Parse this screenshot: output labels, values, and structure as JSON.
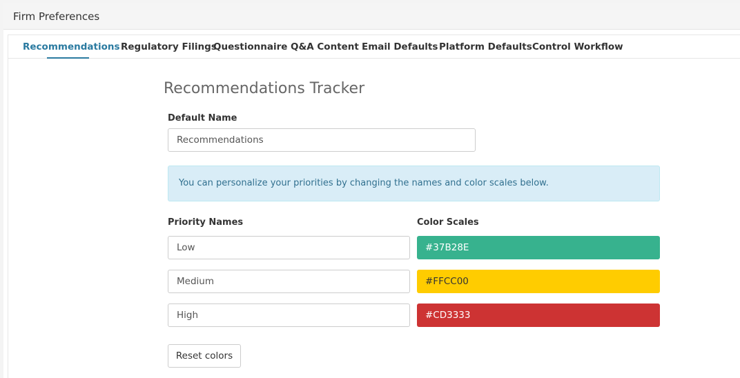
{
  "header": {
    "title": "Firm Preferences"
  },
  "tabs": [
    {
      "label": "Recommendations",
      "active": true
    },
    {
      "label": "Regulatory Filings",
      "active": false
    },
    {
      "label": "Questionnaire",
      "active": false
    },
    {
      "label": "Q&A Content",
      "active": false
    },
    {
      "label": "Email Defaults",
      "active": false
    },
    {
      "label": "Platform Defaults",
      "active": false
    },
    {
      "label": "Control Workflow",
      "active": false
    }
  ],
  "colors": {
    "accent": "#2A7AA0",
    "info_bg": "#D9EDF7",
    "info_text": "#31708F"
  },
  "main": {
    "title": "Recommendations Tracker",
    "default_name_label": "Default Name",
    "default_name_value": "Recommendations",
    "info_text": "You can personalize your priorities by changing the names and color scales below.",
    "priority_names_label": "Priority Names",
    "color_scales_label": "Color Scales",
    "priorities": [
      {
        "name": "Low",
        "color": "#37B28E",
        "text_color": "#ffffff"
      },
      {
        "name": "Medium",
        "color": "#FFCC00",
        "text_color": "#333333"
      },
      {
        "name": "High",
        "color": "#CD3333",
        "text_color": "#ffffff"
      }
    ],
    "reset_button": "Reset colors"
  }
}
